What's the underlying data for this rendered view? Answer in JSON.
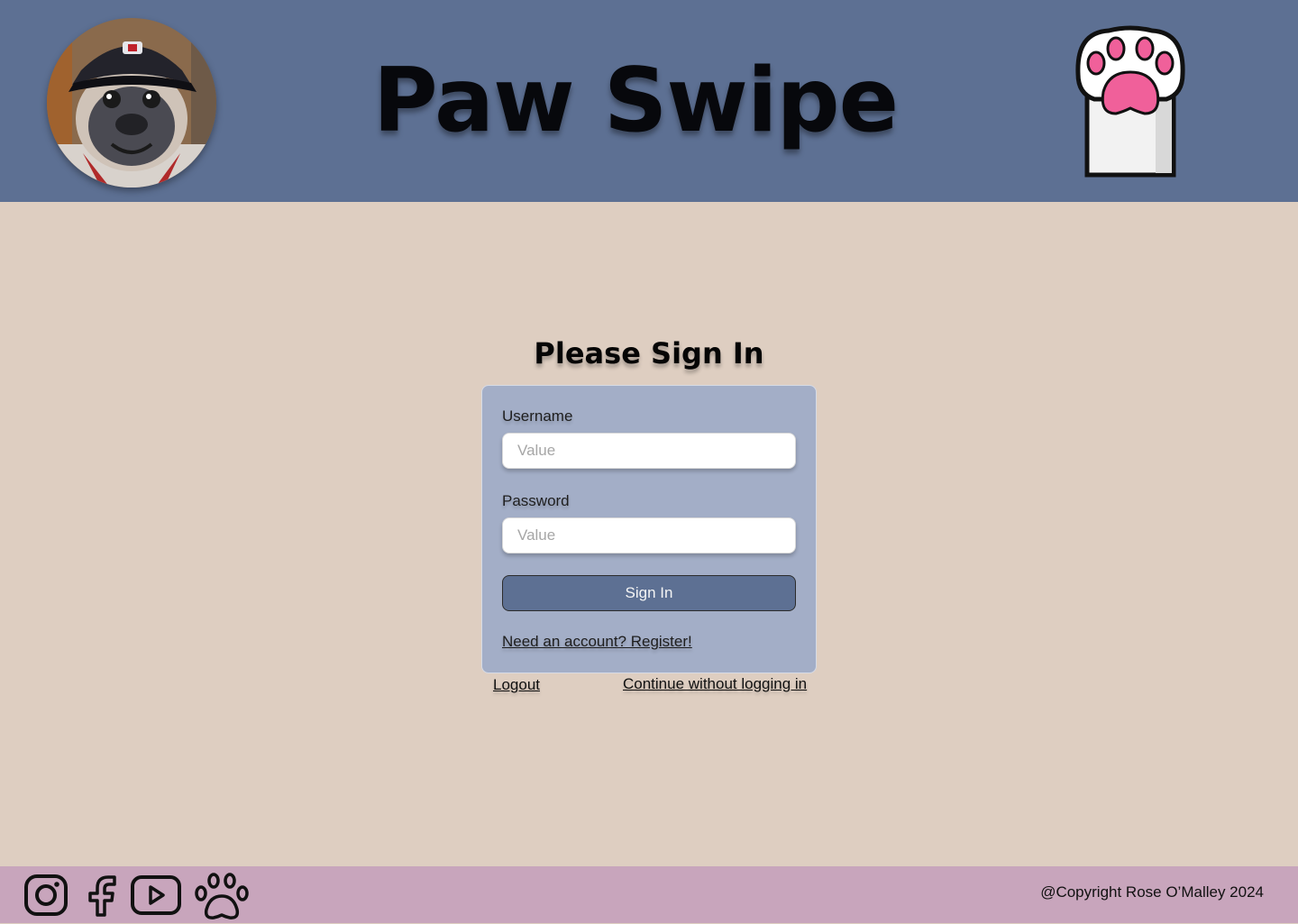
{
  "header": {
    "title": "Paw Swipe",
    "avatar_icon": "pug-avatar-icon",
    "logo_icon": "paw-logo-icon"
  },
  "signin": {
    "heading": "Please Sign In",
    "username_label": "Username",
    "username_placeholder": "Value",
    "password_label": "Password",
    "password_placeholder": "Value",
    "submit_label": "Sign In",
    "register_link": "Need an account? Register!",
    "logout_link": "Logout",
    "guest_link": "Continue without logging in"
  },
  "footer": {
    "social_icons": [
      "instagram-icon",
      "facebook-icon",
      "youtube-icon",
      "paw-icon"
    ],
    "copyright": "@Copyright Rose O’Malley 2024"
  },
  "colors": {
    "header_bg": "#5d7093",
    "page_bg": "#decec1",
    "card_bg": "#a3aec7",
    "button_bg": "#5d7093",
    "footer_bg": "#c8a5bc",
    "paw_pad": "#f0609a"
  }
}
